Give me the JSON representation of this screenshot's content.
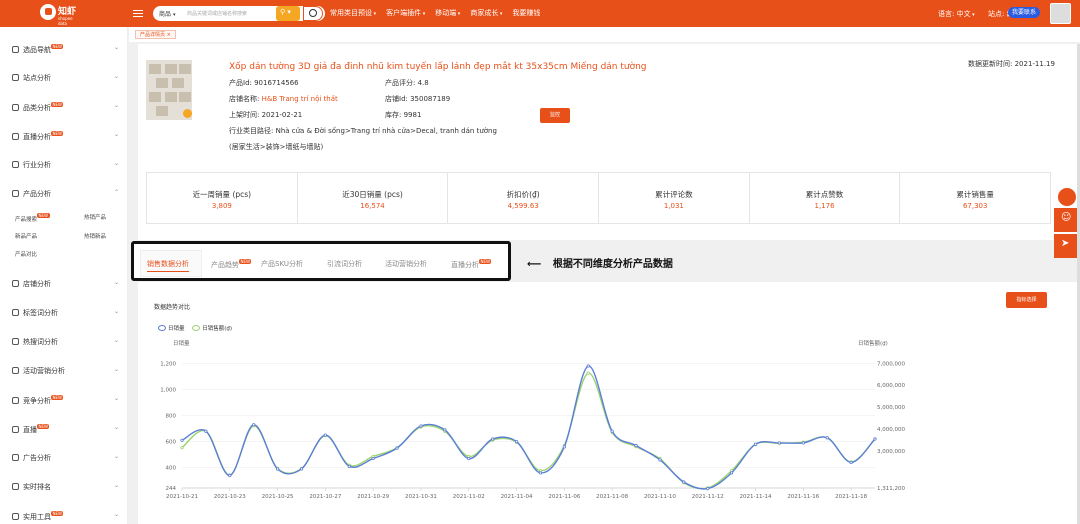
{
  "topbar": {
    "logo_text": "知虾",
    "logo_sub": "shopee data",
    "search_category": "商品",
    "search_placeholder": "商品关键词或店铺名称搜索",
    "nav": [
      "常用类目预设",
      "客户端插件",
      "移动端",
      "商家成长",
      "我要赚钱"
    ],
    "nav_dropdown": [
      true,
      true,
      true,
      true,
      false
    ],
    "language": "语言: 中文",
    "site": "站点: 越南",
    "badge": "我要联系"
  },
  "sidebar": {
    "items": [
      {
        "label": "选品导航",
        "new": true,
        "chev": true
      },
      {
        "label": "站点分析",
        "new": false,
        "chev": true
      },
      {
        "label": "品类分析",
        "new": true,
        "chev": true
      },
      {
        "label": "直播分析",
        "new": true,
        "chev": true
      },
      {
        "label": "行业分析",
        "new": false,
        "chev": true
      },
      {
        "label": "产品分析",
        "new": false,
        "chev": true
      },
      {
        "label": "店铺分析",
        "new": false,
        "chev": true
      },
      {
        "label": "标签词分析",
        "new": false,
        "chev": true
      },
      {
        "label": "热搜词分析",
        "new": false,
        "chev": true
      },
      {
        "label": "活动营销分析",
        "new": false,
        "chev": true
      },
      {
        "label": "竞争分析",
        "new": true,
        "chev": true
      },
      {
        "label": "直播",
        "new": true,
        "chev": true
      },
      {
        "label": "广告分析",
        "new": false,
        "chev": true
      },
      {
        "label": "实时排名",
        "new": false,
        "chev": true
      },
      {
        "label": "实用工具",
        "new": true,
        "chev": true
      }
    ],
    "sub": {
      "a": "产品搜索",
      "b": "热销产品",
      "c": "新品产品",
      "d": "热销新品",
      "e": "产品对比",
      "new_a": true
    }
  },
  "tabbar": {
    "chip": "产品详情页 ×"
  },
  "product": {
    "title": "Xốp dán tường 3D giả đa đinh nhũ kim tuyến lấp lánh đẹp mắt kt 35x35cm Miếng dán tường",
    "update_label": "数据更新时间: 2021-11.19",
    "id_label": "产品Id: 9016714566",
    "rating_label": "产品评分: 4.8",
    "shop_label": "店铺名称:",
    "shop_name": "H&B Trang trí nội thất",
    "shop_id_label": "店铺Id: 350087189",
    "listed_label": "上架时间: 2021-02-21",
    "stock_label": "库存: 9981",
    "monitor_btn": "监控",
    "category_line1": "行业类目路径: Nhà cửa & Đời sống>Trang trí nhà cửa>Decal, tranh dán tường",
    "category_line2": "(居家生活>装饰>墙纸与墙贴)"
  },
  "stats": [
    {
      "label": "近一周销量 (pcs)",
      "value": "3,809"
    },
    {
      "label": "近30日销量 (pcs)",
      "value": "16,574"
    },
    {
      "label": "折扣价(₫)",
      "value": "4,599.63"
    },
    {
      "label": "累计评论数",
      "value": "1,031"
    },
    {
      "label": "累计点赞数",
      "value": "1,176"
    },
    {
      "label": "累计销售量",
      "value": "67,303"
    }
  ],
  "tabs": [
    {
      "label": "销售数据分析",
      "active": true,
      "new": false
    },
    {
      "label": "产品趋势",
      "active": false,
      "new": true
    },
    {
      "label": "产品SKU分析",
      "active": false,
      "new": false
    },
    {
      "label": "引流词分析",
      "active": false,
      "new": false
    },
    {
      "label": "活动营销分析",
      "active": false,
      "new": false
    },
    {
      "label": "直播分析",
      "active": false,
      "new": true
    }
  ],
  "annotation": "根据不同维度分析产品数据",
  "new_badge": "NEW",
  "chart": {
    "title": "数据趋势对比",
    "filter_btn": "指标选择",
    "legend": [
      "日销量",
      "日销售额(₫)"
    ],
    "left_axis_label": "日销量",
    "right_axis_label": "日销售额(₫)",
    "colors": {
      "sales": "#5b7fd6",
      "revenue": "#9dd36e"
    }
  },
  "chart_data": {
    "type": "line",
    "x": [
      "2021-10-21",
      "2021-10-22",
      "2021-10-23",
      "2021-10-24",
      "2021-10-25",
      "2021-10-26",
      "2021-10-27",
      "2021-10-28",
      "2021-10-29",
      "2021-10-30",
      "2021-10-31",
      "2021-11-01",
      "2021-11-02",
      "2021-11-03",
      "2021-11-04",
      "2021-11-05",
      "2021-11-06",
      "2021-11-07",
      "2021-11-08",
      "2021-11-09",
      "2021-11-10",
      "2021-11-11",
      "2021-11-12",
      "2021-11-13",
      "2021-11-14",
      "2021-11-15",
      "2021-11-16",
      "2021-11-17",
      "2021-11-18",
      "2021-11-19"
    ],
    "x_ticks": [
      "2021-10-21",
      "2021-10-23",
      "2021-10-25",
      "2021-10-27",
      "2021-10-29",
      "2021-10-31",
      "2021-11-02",
      "2021-11-04",
      "2021-11-06",
      "2021-11-08",
      "2021-11-10",
      "2021-11-12",
      "2021-11-14",
      "2021-11-16",
      "2021-11-18"
    ],
    "y_left_ticks": [
      "244",
      "400",
      "600",
      "800",
      "1,000",
      "1,200"
    ],
    "y_left_lim": [
      244,
      1280
    ],
    "y_right_ticks": [
      "1,311,200",
      "3,000,000",
      "4,000,000",
      "5,000,000",
      "6,000,000",
      "7,000,000"
    ],
    "y_right_lim": [
      1311200,
      7470000
    ],
    "series": [
      {
        "name": "日销量",
        "axis": "left",
        "values": [
          610,
          680,
          340,
          730,
          390,
          390,
          650,
          410,
          470,
          550,
          720,
          690,
          470,
          620,
          600,
          360,
          560,
          1180,
          680,
          570,
          460,
          290,
          240,
          360,
          580,
          590,
          590,
          630,
          440,
          620
        ]
      },
      {
        "name": "日销售额(₫)",
        "axis": "right",
        "values": [
          3150000,
          3900000,
          1900000,
          4150000,
          2200000,
          2200000,
          3700000,
          2350000,
          2750000,
          3150000,
          4100000,
          3900000,
          2750000,
          3500000,
          3400000,
          2100000,
          3250000,
          6550000,
          3850000,
          3200000,
          2650000,
          1550000,
          1311200,
          2100000,
          3300000,
          3350000,
          3400000,
          3600000,
          2500000,
          3550000
        ]
      }
    ]
  }
}
